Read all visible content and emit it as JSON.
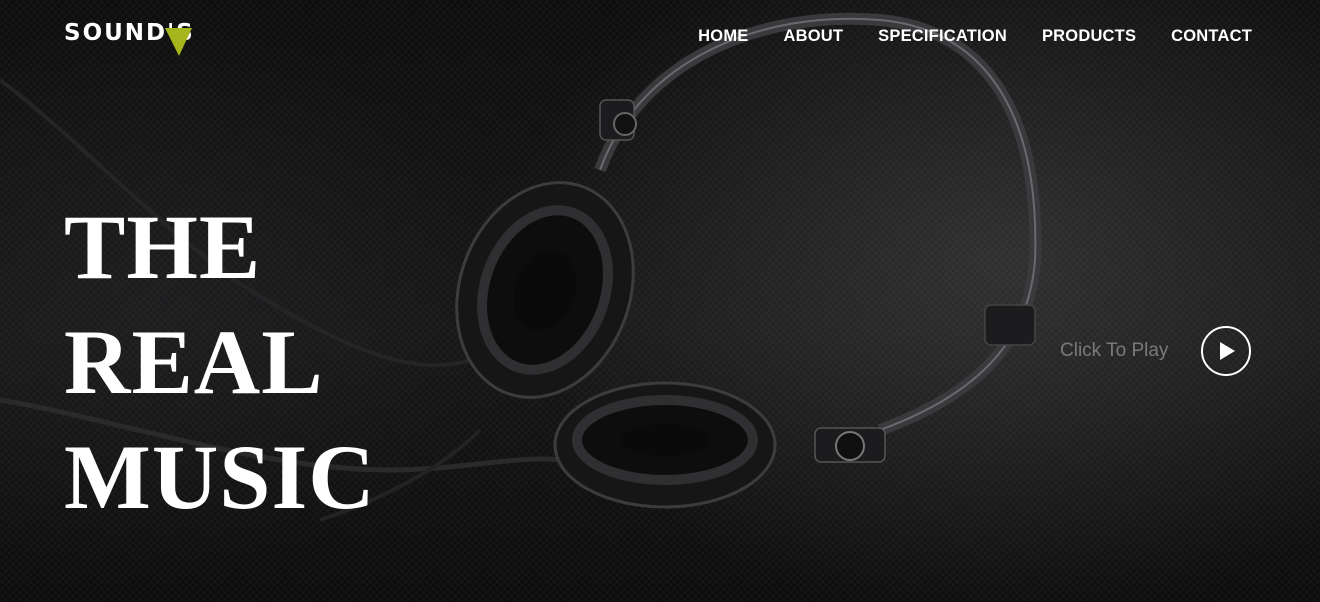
{
  "brand": {
    "name": "SOUND'S",
    "accent_color": "#a6b51c",
    "mark_icon": "triangle-icon"
  },
  "nav": {
    "items": [
      {
        "label": "HOME"
      },
      {
        "label": "ABOUT"
      },
      {
        "label": "SPECIFICATION"
      },
      {
        "label": "PRODUCTS"
      },
      {
        "label": "CONTACT"
      }
    ]
  },
  "hero": {
    "lines": [
      "THE",
      "REAL",
      "MUSIC"
    ],
    "play_label": "Click To Play",
    "play_icon": "play-icon"
  },
  "colors": {
    "background": "#0b0b0c",
    "text": "#ffffff",
    "muted": "#7a7a7c"
  }
}
